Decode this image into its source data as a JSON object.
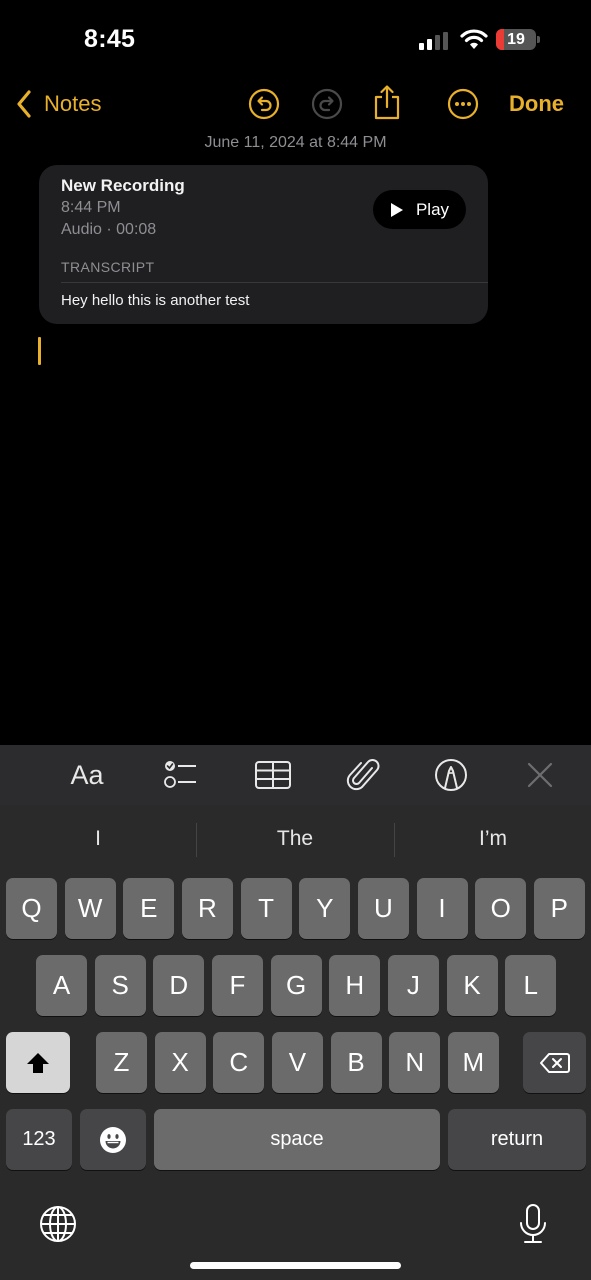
{
  "status_bar": {
    "time": "8:45",
    "signal_bars_active": 2,
    "signal_bars_total": 4,
    "battery_percent": 19,
    "battery_label": "19",
    "battery_low_color": "#eb3b35"
  },
  "nav": {
    "back_label": "Notes",
    "done_label": "Done",
    "accent_color": "#e8b02b",
    "icons": [
      "undo-icon",
      "redo-icon",
      "share-icon",
      "more-icon"
    ]
  },
  "note": {
    "date": "June 11, 2024 at 8:44 PM",
    "recording": {
      "title": "New Recording",
      "time": "8:44 PM",
      "meta": "Audio · 00:08",
      "play_label": "Play",
      "transcript_label": "TRANSCRIPT",
      "transcript_text": "Hey hello this is another test"
    }
  },
  "format_toolbar": {
    "text_style_label": "Aa",
    "icons": [
      "checklist-icon",
      "table-icon",
      "attachment-icon",
      "markup-icon",
      "close-icon"
    ]
  },
  "keyboard": {
    "suggestions": [
      "I",
      "The",
      "I’m"
    ],
    "rows": [
      [
        "Q",
        "W",
        "E",
        "R",
        "T",
        "Y",
        "U",
        "I",
        "O",
        "P"
      ],
      [
        "A",
        "S",
        "D",
        "F",
        "G",
        "H",
        "J",
        "K",
        "L"
      ],
      [
        "Z",
        "X",
        "C",
        "V",
        "B",
        "N",
        "M"
      ]
    ],
    "numbers_label": "123",
    "space_label": "space",
    "return_label": "return"
  }
}
